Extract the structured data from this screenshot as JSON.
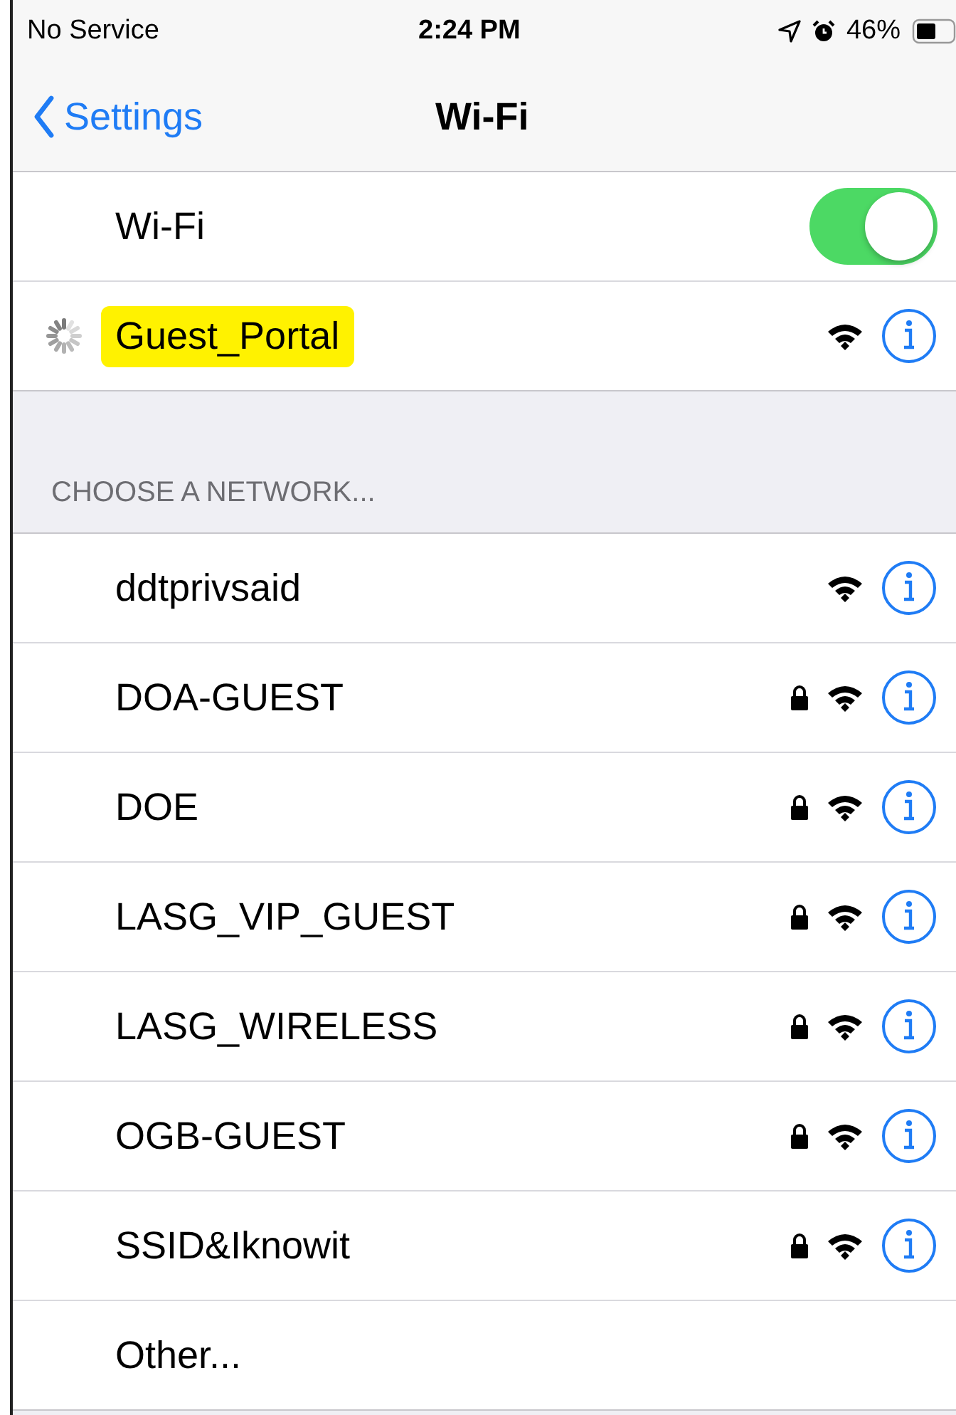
{
  "status_bar": {
    "carrier": "No Service",
    "time": "2:24 PM",
    "battery": "46%"
  },
  "nav": {
    "back": "Settings",
    "title": "Wi-Fi"
  },
  "wifi_toggle": {
    "label": "Wi-Fi",
    "on": true
  },
  "current_network": {
    "name": "Guest_Portal",
    "connecting": true,
    "highlighted": true
  },
  "section_header": "CHOOSE A NETWORK...",
  "networks": [
    {
      "kind": "network",
      "name": "ddtprivsaid",
      "locked": false
    },
    {
      "kind": "network",
      "name": "DOA-GUEST",
      "locked": true
    },
    {
      "kind": "network",
      "name": "DOE",
      "locked": true
    },
    {
      "kind": "network",
      "name": "LASG_VIP_GUEST",
      "locked": true
    },
    {
      "kind": "network",
      "name": "LASG_WIRELESS",
      "locked": true
    },
    {
      "kind": "network",
      "name": "OGB-GUEST",
      "locked": true
    },
    {
      "kind": "network",
      "name": "SSID&Iknowit",
      "locked": true
    },
    {
      "kind": "other",
      "name": "Other..."
    }
  ]
}
